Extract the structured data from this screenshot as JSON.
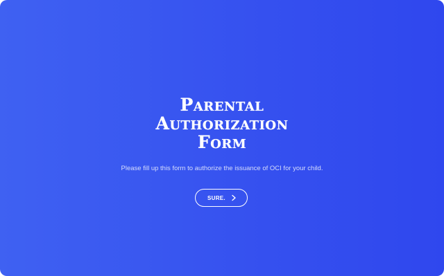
{
  "form": {
    "title_lines": [
      "Parental",
      "Authorization",
      "Form"
    ],
    "subtitle": "Please fill up this form to authorize the issuance of OCI for your child.",
    "start_button_label": "SURE.",
    "start_button_icon": "chevron-right-icon"
  },
  "colors": {
    "background_start": "#3f61f2",
    "background_end": "#2f47ee",
    "text": "#ffffff"
  }
}
